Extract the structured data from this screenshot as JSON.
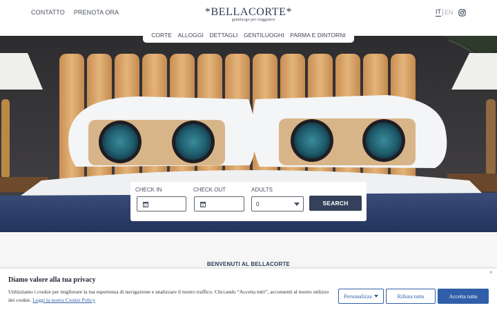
{
  "header": {
    "links": [
      "CONTATTO",
      "PRENOTA ORA"
    ],
    "logo_title": "*BELLACORTE*",
    "logo_subtitle": "gentiluogo per viaggiatori",
    "lang_active": "IT",
    "lang_other": "EN",
    "social_icon": "instagram-icon"
  },
  "nav": {
    "items": [
      "CORTE",
      "ALLOGGI",
      "DETTAGLI",
      "GENTILUOGHI",
      "PARMA E DINTORNI"
    ]
  },
  "search": {
    "checkin_label": "CHECK IN",
    "checkout_label": "CHECK OUT",
    "adults_label": "ADULTS",
    "adults_value": "0",
    "button_label": "SEARCH",
    "calendar_icon": "calendar-icon"
  },
  "content": {
    "welcome": "BENVENUTI AL BELLACORTE"
  },
  "cookie": {
    "title": "Diamo valore alla tua privacy",
    "text": "Utilizziamo i cookie per migliorare la tua esperienza di navigazione e analizzare il nostro traffico. Cliccando “Accetta tutti”, acconsenti al nostro utilizzo dei cookie.",
    "link": "Leggi la nostra Cookie Policy",
    "customize_label": "Personalizza",
    "reject_label": "Rifiuta tutto",
    "accept_label": "Accetta tutto",
    "close_glyph": "×"
  },
  "colors": {
    "brand_navy": "#35405a",
    "cookie_blue": "#2f5fa8",
    "headboard": "#d9a56a",
    "blanket": "#2c3d66"
  }
}
